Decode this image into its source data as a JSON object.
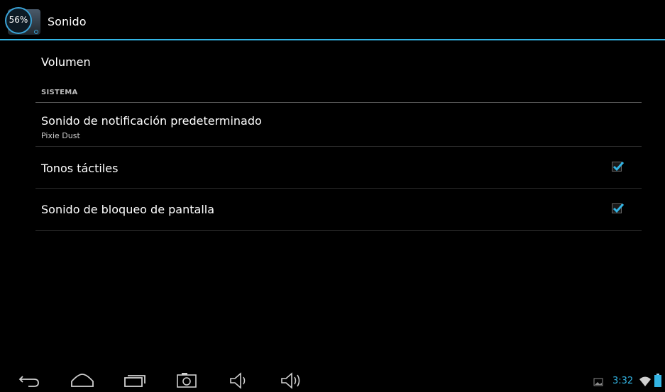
{
  "header": {
    "battery_percent": "56%",
    "title": "Sonido"
  },
  "list": {
    "volume": {
      "label": "Volumen"
    },
    "section_system": "SISTEMA",
    "notification": {
      "label": "Sonido de notificación predeterminado",
      "value": "Pixie Dust"
    },
    "touch_tones": {
      "label": "Tonos táctiles",
      "checked": true
    },
    "lock_sound": {
      "label": "Sonido de bloqueo de pantalla",
      "checked": true
    }
  },
  "navbar": {
    "icons": [
      "back-icon",
      "home-icon",
      "recent-apps-icon",
      "screenshot-icon",
      "volume-down-icon",
      "volume-up-icon"
    ]
  },
  "status": {
    "time": "3:32",
    "icons": [
      "gallery-notification-icon",
      "wifi-icon",
      "battery-icon"
    ]
  },
  "colors": {
    "accent": "#33b5e5",
    "background": "#000000",
    "divider": "#2e2e2e"
  }
}
